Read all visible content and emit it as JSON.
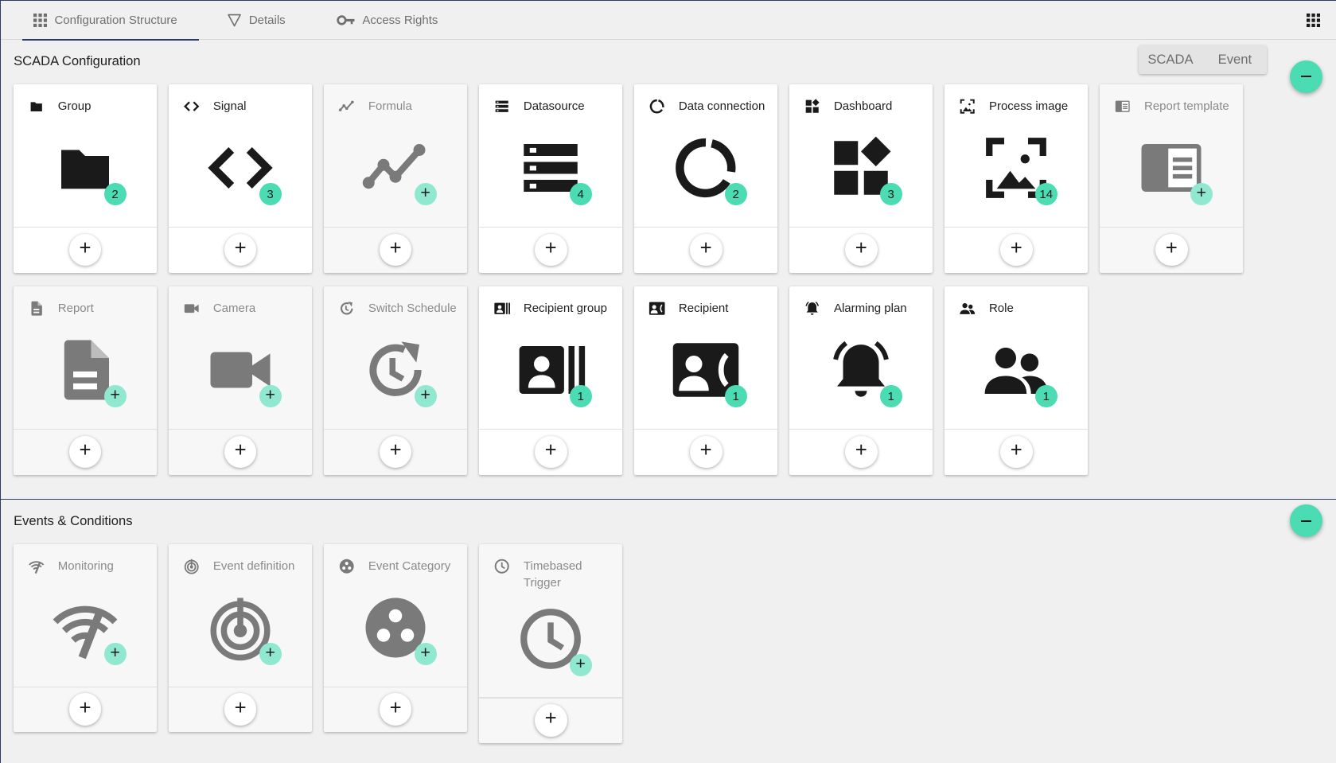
{
  "tabs": [
    {
      "label": "Configuration Structure",
      "icon": "grid-icon",
      "active": true
    },
    {
      "label": "Details",
      "icon": "filter-icon",
      "active": false
    },
    {
      "label": "Access Rights",
      "icon": "key-icon",
      "active": false
    }
  ],
  "scada": {
    "title": "SCADA Configuration",
    "toggle": [
      "SCADA",
      "Event"
    ],
    "cards": [
      {
        "label": "Group",
        "icon": "folder-icon",
        "badge": "2",
        "enabled": true
      },
      {
        "label": "Signal",
        "icon": "code-icon",
        "badge": "3",
        "enabled": true
      },
      {
        "label": "Formula",
        "icon": "trend-line-icon",
        "badge": "+",
        "enabled": false
      },
      {
        "label": "Datasource",
        "icon": "storage-list-icon",
        "badge": "4",
        "enabled": true
      },
      {
        "label": "Data connection",
        "icon": "ring-icon",
        "badge": "2",
        "enabled": true
      },
      {
        "label": "Dashboard",
        "icon": "widgets-icon",
        "badge": "3",
        "enabled": true
      },
      {
        "label": "Process image",
        "icon": "image-frame-icon",
        "badge": "14",
        "enabled": true
      },
      {
        "label": "Report template",
        "icon": "report-template-icon",
        "badge": "+",
        "enabled": false
      },
      {
        "label": "Report",
        "icon": "document-icon",
        "badge": "+",
        "enabled": false
      },
      {
        "label": "Camera",
        "icon": "videocam-icon",
        "badge": "+",
        "enabled": false
      },
      {
        "label": "Switch Schedule",
        "icon": "schedule-refresh-icon",
        "badge": "+",
        "enabled": false
      },
      {
        "label": "Recipient group",
        "icon": "contact-group-icon",
        "badge": "1",
        "enabled": true
      },
      {
        "label": "Recipient",
        "icon": "contact-phone-icon",
        "badge": "1",
        "enabled": true
      },
      {
        "label": "Alarming plan",
        "icon": "alarm-bell-icon",
        "badge": "1",
        "enabled": true
      },
      {
        "label": "Role",
        "icon": "people-icon",
        "badge": "1",
        "enabled": true
      }
    ]
  },
  "events": {
    "title": "Events & Conditions",
    "cards": [
      {
        "label": "Monitoring",
        "icon": "monitoring-icon",
        "badge": "+",
        "enabled": false
      },
      {
        "label": "Event definition",
        "icon": "radar-icon",
        "badge": "+",
        "enabled": false
      },
      {
        "label": "Event Category",
        "icon": "category-icon",
        "badge": "+",
        "enabled": false
      },
      {
        "label": "Timebased Trigger",
        "icon": "clock-icon",
        "badge": "+",
        "enabled": false
      }
    ]
  },
  "colors": {
    "accent": "#4cdcb4",
    "nav_line": "#2b3a67",
    "icon_dark": "#1a1a1a",
    "icon_disabled": "#7a7a7a"
  }
}
